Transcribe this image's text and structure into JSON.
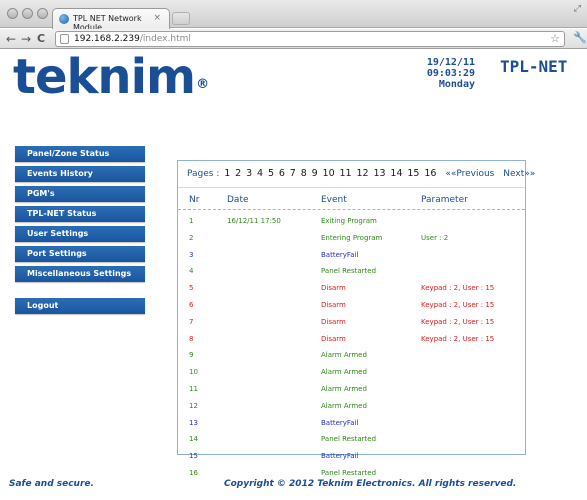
{
  "browser": {
    "tab_title": "TPL NET Network Module",
    "tab_close": "×",
    "url_host": "192.168.2.239",
    "url_path": "/index.html",
    "back_glyph": "←",
    "forward_glyph": "→",
    "reload_glyph": "C",
    "star_glyph": "☆",
    "wrench_glyph": "🔧",
    "resize_glyph": "⤢"
  },
  "header": {
    "logo": "teknim",
    "logo_mark": "®",
    "date": "19/12/11",
    "time": "09:03:29",
    "weekday": "Monday",
    "product": "TPL-NET"
  },
  "menu": {
    "items": [
      "Panel/Zone Status",
      "Events History",
      "PGM's",
      "TPL-NET Status",
      "User Settings",
      "Port Settings",
      "Miscellaneous Settings"
    ],
    "logout": "Logout"
  },
  "pager": {
    "label": "Pages :",
    "pages": [
      "1",
      "2",
      "3",
      "4",
      "5",
      "6",
      "7",
      "8",
      "9",
      "10",
      "11",
      "12",
      "13",
      "14",
      "15",
      "16"
    ],
    "previous": "««Previous",
    "next": "Next»»"
  },
  "table": {
    "headers": {
      "nr": "Nr",
      "date": "Date",
      "event": "Event",
      "parameter": "Parameter"
    },
    "rows": [
      {
        "nr": "1",
        "date": "16/12/11 17:50",
        "event": "Exiting Program",
        "parameter": "",
        "color": "#2e8b17"
      },
      {
        "nr": "2",
        "date": "",
        "event": "Entering Program",
        "parameter": "User : 2",
        "color": "#2e8b17"
      },
      {
        "nr": "3",
        "date": "",
        "event": "BatteryFail",
        "parameter": "",
        "color": "#1f2fd0"
      },
      {
        "nr": "4",
        "date": "",
        "event": "Panel Restarted",
        "parameter": "",
        "color": "#2e8b17"
      },
      {
        "nr": "5",
        "date": "",
        "event": "Disarm",
        "parameter": "Keypad : 2, User : 15",
        "color": "#e01b1b"
      },
      {
        "nr": "6",
        "date": "",
        "event": "Disarm",
        "parameter": "Keypad : 2, User : 15",
        "color": "#e01b1b"
      },
      {
        "nr": "7",
        "date": "",
        "event": "Disarm",
        "parameter": "Keypad : 2, User : 15",
        "color": "#e01b1b"
      },
      {
        "nr": "8",
        "date": "",
        "event": "Disarm",
        "parameter": "Keypad : 2, User : 15",
        "color": "#e01b1b"
      },
      {
        "nr": "9",
        "date": "",
        "event": "Alarm Armed",
        "parameter": "",
        "color": "#2e8b17"
      },
      {
        "nr": "10",
        "date": "",
        "event": "Alarm Armed",
        "parameter": "",
        "color": "#2e8b17"
      },
      {
        "nr": "11",
        "date": "",
        "event": "Alarm Armed",
        "parameter": "",
        "color": "#2e8b17"
      },
      {
        "nr": "12",
        "date": "",
        "event": "Alarm Armed",
        "parameter": "",
        "color": "#2e8b17"
      },
      {
        "nr": "13",
        "date": "",
        "event": "BatteryFail",
        "parameter": "",
        "color": "#1f2fd0"
      },
      {
        "nr": "14",
        "date": "",
        "event": "Panel Restarted",
        "parameter": "",
        "color": "#2e8b17"
      },
      {
        "nr": "15",
        "date": "",
        "event": "BatteryFail",
        "parameter": "",
        "color": "#1f2fd0"
      },
      {
        "nr": "16",
        "date": "",
        "event": "Panel Restarted",
        "parameter": "",
        "color": "#2e8b17"
      }
    ]
  },
  "footer": {
    "left": "Safe and secure.",
    "right": "Copyright © 2012 Teknim Electronics. All rights reserved."
  },
  "colors": {
    "brand_blue": "#1b4f95",
    "menu_blue": "#2266ad",
    "ok_green": "#2e8b17",
    "alert_red": "#e01b1b",
    "info_blue": "#1f2fd0"
  }
}
